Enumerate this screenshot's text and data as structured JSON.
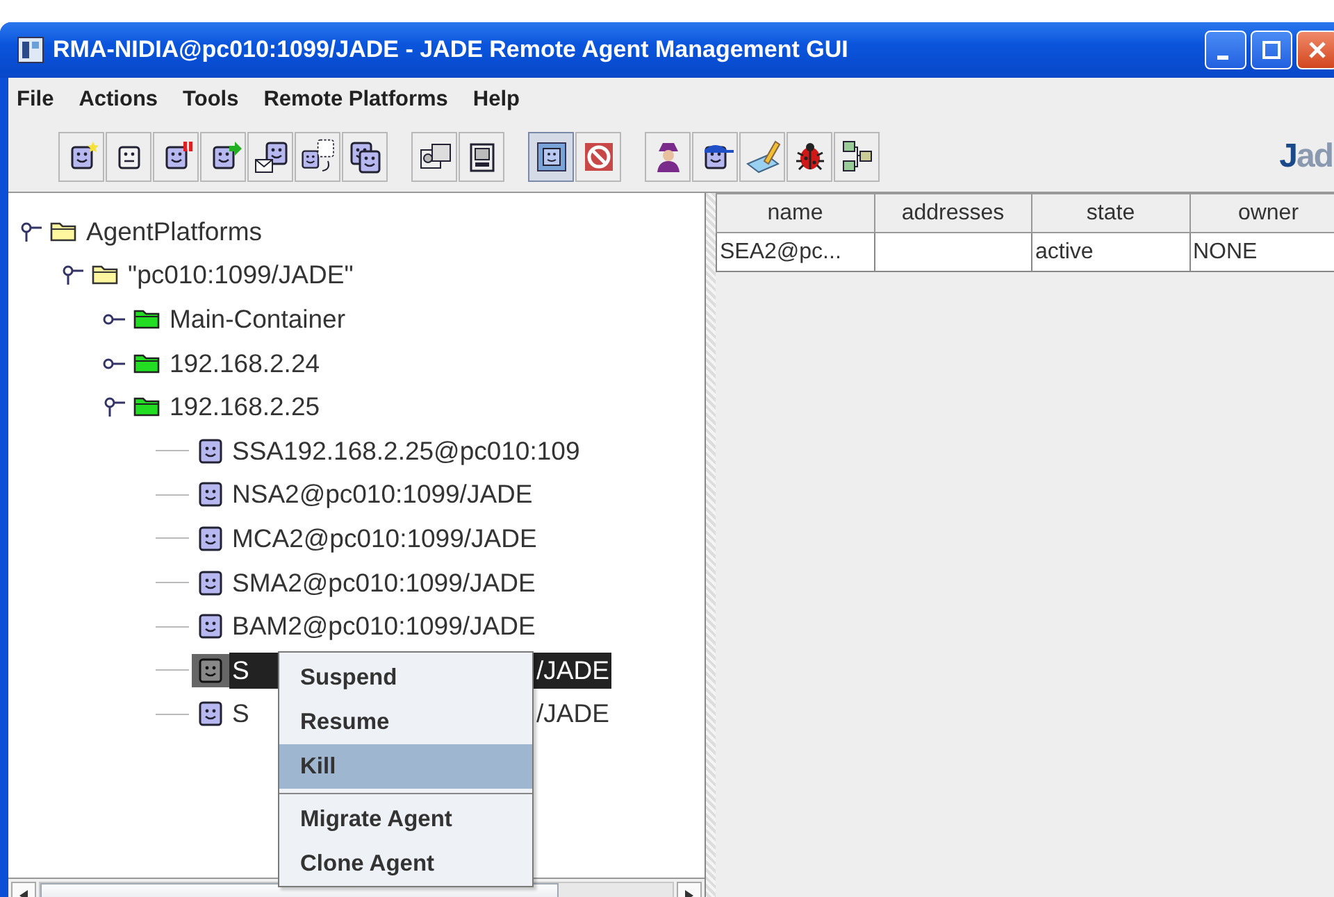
{
  "window": {
    "title": "RMA-NIDIA@pc010:1099/JADE - JADE Remote Agent Management GUI"
  },
  "menu": [
    "File",
    "Actions",
    "Tools",
    "Remote Platforms",
    "Help"
  ],
  "toolbar": {
    "groups": [
      [
        {
          "kind": "face-star"
        },
        {
          "kind": "face-plain"
        },
        {
          "kind": "face-pause"
        },
        {
          "kind": "face-arrow"
        },
        {
          "kind": "face-mail"
        },
        {
          "kind": "face-clone"
        },
        {
          "kind": "face-pair"
        }
      ],
      [
        {
          "kind": "box-face"
        },
        {
          "kind": "box-face-dark"
        }
      ],
      [
        {
          "kind": "screen-face"
        },
        {
          "kind": "no-sign"
        }
      ],
      [
        {
          "kind": "figure"
        },
        {
          "kind": "face-cap"
        },
        {
          "kind": "pencil"
        },
        {
          "kind": "bug"
        },
        {
          "kind": "network"
        }
      ]
    ],
    "logo": "Jad"
  },
  "tree": [
    {
      "kind": "platform",
      "label": "AgentPlatforms",
      "expanded": true,
      "selected": false,
      "children": [
        {
          "kind": "platform",
          "label": "\"pc010:1099/JADE\"",
          "expanded": true,
          "selected": false,
          "children": [
            {
              "kind": "container",
              "label": "Main-Container",
              "expanded": false,
              "selected": false
            },
            {
              "kind": "container",
              "label": "192.168.2.24",
              "expanded": false,
              "selected": false
            },
            {
              "kind": "container",
              "label": "192.168.2.25",
              "expanded": true,
              "selected": false,
              "children": [
                {
                  "kind": "agent",
                  "label": "SSA192.168.2.25@pc010:109",
                  "selected": false
                },
                {
                  "kind": "agent",
                  "label": "NSA2@pc010:1099/JADE",
                  "selected": false
                },
                {
                  "kind": "agent",
                  "label": "MCA2@pc010:1099/JADE",
                  "selected": false
                },
                {
                  "kind": "agent",
                  "label": "SMA2@pc010:1099/JADE",
                  "selected": false
                },
                {
                  "kind": "agent",
                  "label": "BAM2@pc010:1099/JADE",
                  "selected": false
                },
                {
                  "kind": "agent",
                  "label": "S",
                  "label_tail": "/JADE",
                  "selected": true
                },
                {
                  "kind": "agent",
                  "label": "S",
                  "label_tail": "/JADE",
                  "selected": false
                }
              ]
            }
          ]
        }
      ]
    }
  ],
  "context_menu": [
    {
      "label": "Suspend",
      "selected": false
    },
    {
      "label": "Resume",
      "selected": false
    },
    {
      "label": "Kill",
      "selected": true
    },
    {
      "kind": "separator"
    },
    {
      "label": "Migrate Agent",
      "selected": false
    },
    {
      "label": "Clone Agent",
      "selected": false
    }
  ],
  "table": {
    "columns": [
      "name",
      "addresses",
      "state",
      "owner"
    ],
    "rows": [
      [
        "SEA2@pc...",
        "",
        "active",
        "NONE"
      ]
    ]
  }
}
